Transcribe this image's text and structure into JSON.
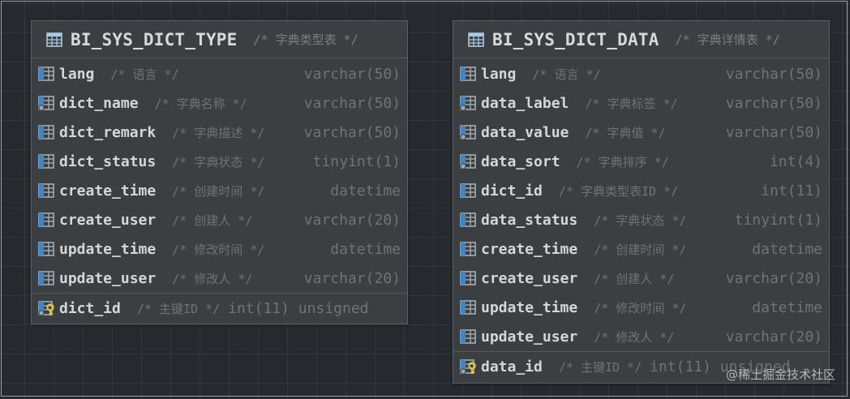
{
  "tables": [
    {
      "name": "BI_SYS_DICT_TYPE",
      "comment": "/* 字典类型表 */",
      "columns": [
        {
          "name": "lang",
          "comment": "/* 语言 */",
          "type": "varchar(50)",
          "icon": "column-icon"
        },
        {
          "name": "dict_name",
          "comment": "/* 字典名称 */",
          "type": "varchar(50)",
          "icon": "indexed-column-icon"
        },
        {
          "name": "dict_remark",
          "comment": "/* 字典描述 */",
          "type": "varchar(50)",
          "icon": "column-icon"
        },
        {
          "name": "dict_status",
          "comment": "/* 字典状态 */",
          "type": "tinyint(1)",
          "icon": "column-icon"
        },
        {
          "name": "create_time",
          "comment": "/* 创建时间 */",
          "type": "datetime",
          "icon": "column-icon"
        },
        {
          "name": "create_user",
          "comment": "/* 创建人 */",
          "type": "varchar(20)",
          "icon": "column-icon"
        },
        {
          "name": "update_time",
          "comment": "/* 修改时间 */",
          "type": "datetime",
          "icon": "column-icon"
        },
        {
          "name": "update_user",
          "comment": "/* 修改人 */",
          "type": "varchar(20)",
          "icon": "column-icon"
        }
      ],
      "primary_key": {
        "name": "dict_id",
        "comment": "/* 主键ID */",
        "type": "int(11) unsigned",
        "icon": "primary-key-icon"
      }
    },
    {
      "name": "BI_SYS_DICT_DATA",
      "comment": "/* 字典详情表 */",
      "columns": [
        {
          "name": "lang",
          "comment": "/* 语言 */",
          "type": "varchar(50)",
          "icon": "column-icon"
        },
        {
          "name": "data_label",
          "comment": "/* 字典标签 */",
          "type": "varchar(50)",
          "icon": "indexed-column-icon"
        },
        {
          "name": "data_value",
          "comment": "/* 字典值 */",
          "type": "varchar(50)",
          "icon": "indexed-column-icon"
        },
        {
          "name": "data_sort",
          "comment": "/* 字典排序 */",
          "type": "int(4)",
          "icon": "indexed-column-icon"
        },
        {
          "name": "dict_id",
          "comment": "/* 字典类型表ID */",
          "type": "int(11)",
          "icon": "column-icon"
        },
        {
          "name": "data_status",
          "comment": "/* 字典状态 */",
          "type": "tinyint(1)",
          "icon": "column-icon"
        },
        {
          "name": "create_time",
          "comment": "/* 创建时间 */",
          "type": "datetime",
          "icon": "column-icon"
        },
        {
          "name": "create_user",
          "comment": "/* 创建人 */",
          "type": "varchar(20)",
          "icon": "column-icon"
        },
        {
          "name": "update_time",
          "comment": "/* 修改时间 */",
          "type": "datetime",
          "icon": "column-icon"
        },
        {
          "name": "update_user",
          "comment": "/* 修改人 */",
          "type": "varchar(20)",
          "icon": "column-icon"
        }
      ],
      "primary_key": {
        "name": "data_id",
        "comment": "/* 主键ID */",
        "type": "int(11) unsigned",
        "icon": "primary-key-icon"
      }
    }
  ],
  "watermark": "@稀土掘金技术社区",
  "colors": {
    "canvas_bg": "#262a2e",
    "table_bg": "#3c3f41",
    "column_name": "#d4d7da",
    "comment": "#6f7377",
    "icon_blue": "#3e86c8",
    "key_yellow": "#e8c23a"
  }
}
